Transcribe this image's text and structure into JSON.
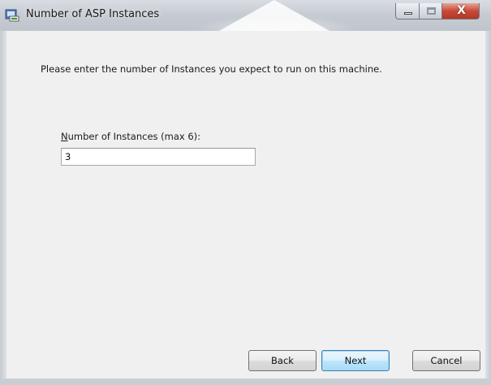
{
  "window": {
    "title": "Number of ASP Instances",
    "controls": {
      "minimize_icon": "minimize-icon",
      "maximize_icon": "maximize-icon",
      "close_icon": "close-icon",
      "close_glyph": "X"
    },
    "app_icon": "installer-icon"
  },
  "main": {
    "instruction": "Please enter the number of Instances you expect to run on this machine.",
    "field": {
      "label_mnemonic": "N",
      "label_rest": "umber of Instances (max 6):",
      "value": "3"
    }
  },
  "footer": {
    "back_label": "Back",
    "next_label": "Next",
    "cancel_label": "Cancel"
  },
  "colors": {
    "close_button": "#c8493a",
    "default_button_border": "#3c7fb1",
    "dialog_background": "#f0f0f0"
  }
}
